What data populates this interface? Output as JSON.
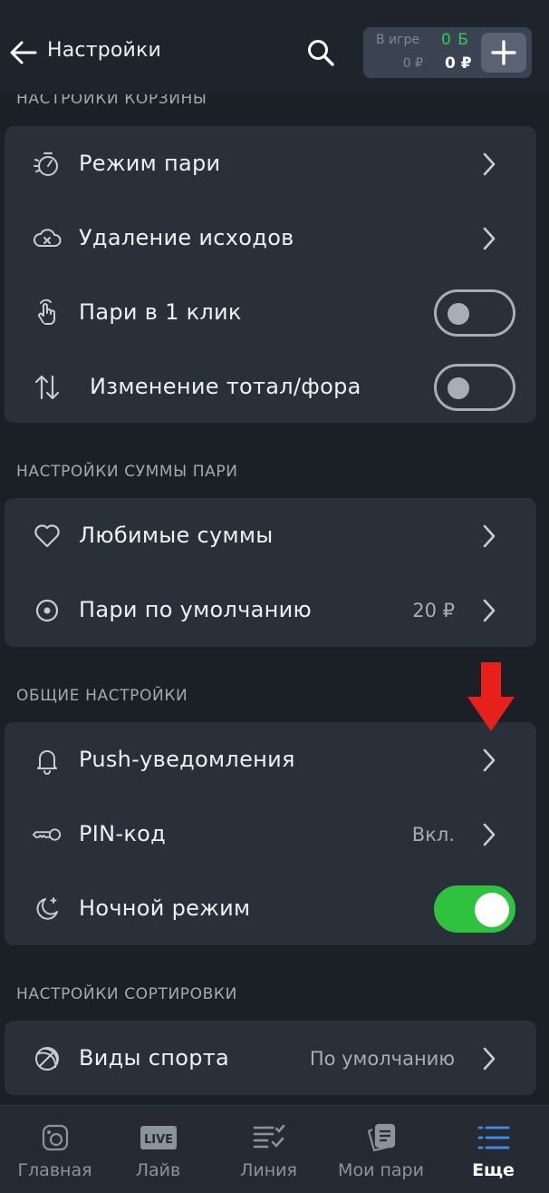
{
  "header": {
    "title": "Настройки",
    "balance": {
      "in_game_label": "В игре",
      "in_game_value": "0 ₽",
      "bonus": "0 Б",
      "money": "0 ₽"
    }
  },
  "sections": {
    "cart": {
      "title": "НАСТРОЙКИ КОРЗИНЫ",
      "rows": [
        {
          "label": "Режим пари"
        },
        {
          "label": "Удаление исходов"
        },
        {
          "label": "Пари в 1 клик",
          "toggle": false
        },
        {
          "label": "Изменение тотал/фора",
          "toggle": false
        }
      ]
    },
    "amount": {
      "title": "НАСТРОЙКИ СУММЫ ПАРИ",
      "rows": [
        {
          "label": "Любимые суммы"
        },
        {
          "label": "Пари по умолчанию",
          "value": "20 ₽"
        }
      ]
    },
    "general": {
      "title": "ОБЩИЕ НАСТРОЙКИ",
      "rows": [
        {
          "label": "Push-уведомления"
        },
        {
          "label": "PIN-код",
          "value": "Вкл."
        },
        {
          "label": "Ночной режим",
          "toggle": true
        }
      ]
    },
    "sorting": {
      "title": "НАСТРОЙКИ СОРТИРОВКИ",
      "rows": [
        {
          "label": "Виды спорта",
          "value": "По умолчанию"
        }
      ]
    }
  },
  "nav": {
    "items": [
      {
        "label": "Главная",
        "badge": "LIVE"
      },
      {
        "label": "Лайв"
      },
      {
        "label": "Линия"
      },
      {
        "label": "Мои пари"
      },
      {
        "label": "Еще"
      }
    ],
    "live_badge": "LIVE",
    "active_index": 4
  },
  "colors": {
    "background": "#1b1f26",
    "card": "#2a3039",
    "toggle_on": "#2fc23e",
    "accent_blue": "#3d8ef0",
    "annotation_red": "#e8201c"
  }
}
